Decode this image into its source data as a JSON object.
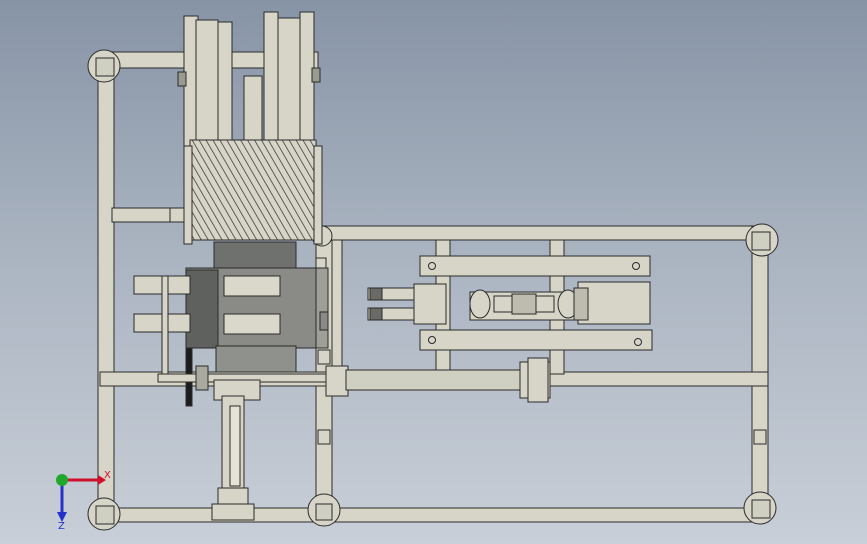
{
  "view": {
    "background_top": "#8794a6",
    "background_bottom": "#c9cfd8",
    "part_fill": "#d6d5c7",
    "part_stroke": "#2b2b2b",
    "dark_fill": "#7f8180",
    "rail_fill": "#c9c8ba"
  },
  "triad": {
    "x_label": "X",
    "z_label": "Z",
    "x_color": "#d0102a",
    "y_color": "#1fa82b",
    "z_color": "#2233cc"
  }
}
